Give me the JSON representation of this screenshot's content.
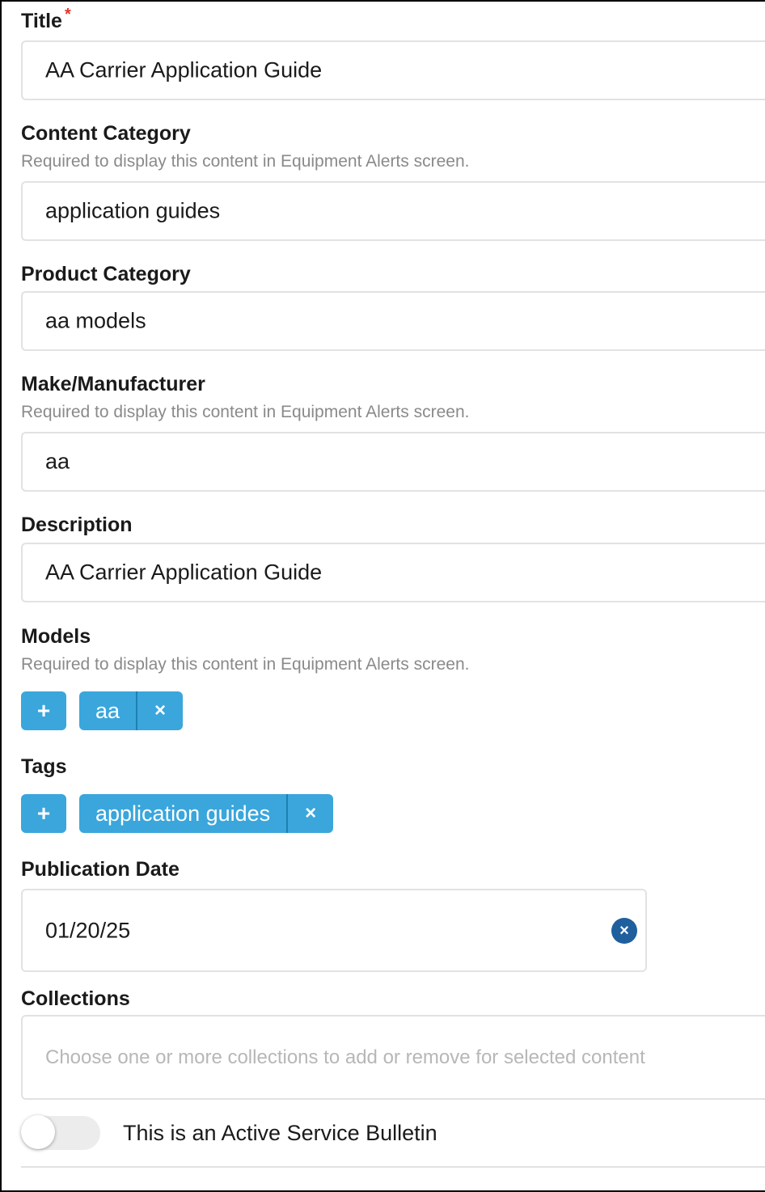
{
  "form": {
    "title": {
      "label": "Title",
      "required_mark": "*",
      "value": "AA Carrier Application Guide"
    },
    "content_category": {
      "label": "Content Category",
      "help": "Required to display this content in Equipment Alerts screen.",
      "value": "application guides"
    },
    "product_category": {
      "label": "Product Category",
      "value": "aa models"
    },
    "make_manufacturer": {
      "label": "Make/Manufacturer",
      "help": "Required to display this content in Equipment Alerts screen.",
      "value": "aa"
    },
    "description": {
      "label": "Description",
      "value": "AA Carrier Application Guide"
    },
    "models": {
      "label": "Models",
      "help": "Required to display this content in Equipment Alerts screen.",
      "add_label": "+",
      "chips": [
        {
          "label": "aa",
          "remove": "×"
        }
      ]
    },
    "tags": {
      "label": "Tags",
      "add_label": "+",
      "chips": [
        {
          "label": "application guides",
          "remove": "×"
        }
      ]
    },
    "publication_date": {
      "label": "Publication Date",
      "value": "01/20/25",
      "clear": "×"
    },
    "collections": {
      "label": "Collections",
      "placeholder": "Choose one or more collections to add or remove for selected content"
    },
    "active_bulletin": {
      "label": "This is an Active Service Bulletin",
      "checked": false
    }
  },
  "colors": {
    "chip": "#3aa6dc",
    "clear_button": "#1f5f9e",
    "required": "#e0352b"
  }
}
